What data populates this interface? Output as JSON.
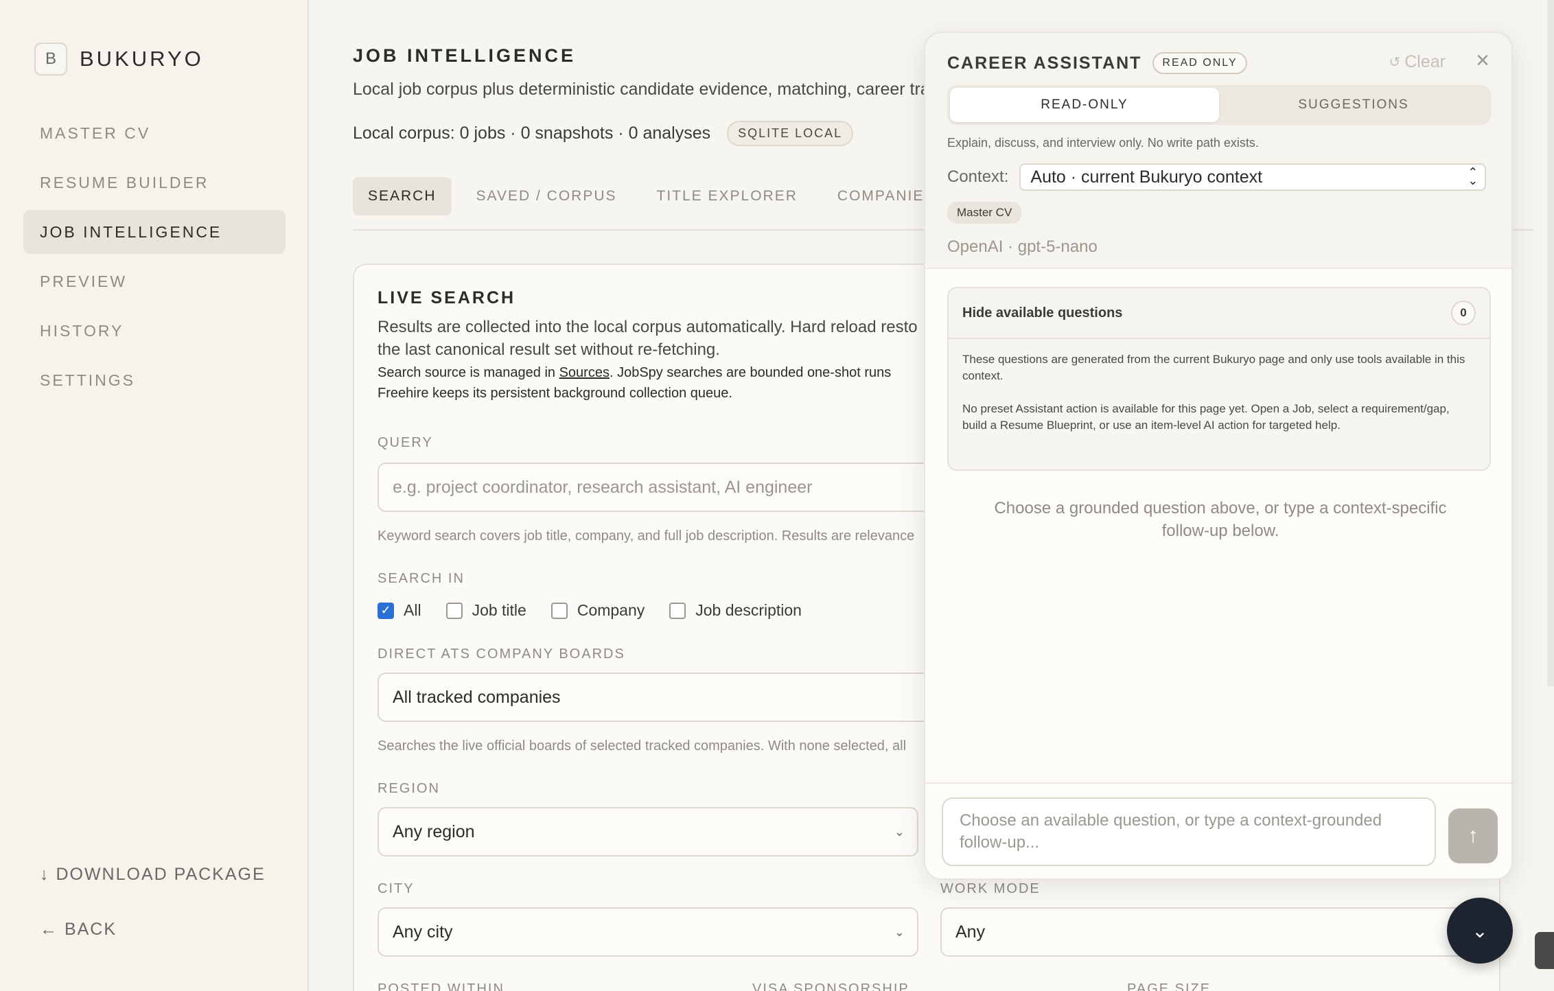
{
  "brand": {
    "mark": "B",
    "name": "BUKURYO"
  },
  "nav": {
    "items": [
      {
        "label": "MASTER CV",
        "active": false
      },
      {
        "label": "RESUME BUILDER",
        "active": false
      },
      {
        "label": "JOB INTELLIGENCE",
        "active": true
      },
      {
        "label": "PREVIEW",
        "active": false
      },
      {
        "label": "HISTORY",
        "active": false
      },
      {
        "label": "SETTINGS",
        "active": false
      }
    ],
    "download": "DOWNLOAD PACKAGE",
    "back": "BACK"
  },
  "page": {
    "title": "JOB INTELLIGENCE",
    "subtitle": "Local job corpus plus deterministic candidate evidence, matching, career tra",
    "corpus": "Local corpus: 0 jobs · 0 snapshots · 0 analyses",
    "storage_badge": "SQLITE LOCAL",
    "tabs": [
      {
        "label": "SEARCH",
        "active": true
      },
      {
        "label": "SAVED / CORPUS",
        "active": false
      },
      {
        "label": "TITLE EXPLORER",
        "active": false
      },
      {
        "label": "COMPANIES",
        "active": false
      }
    ]
  },
  "live_search": {
    "title": "LIVE SEARCH",
    "desc_line1": "Results are collected into the local corpus automatically. Hard reload resto",
    "desc_line2": "the last canonical result set without re-fetching.",
    "note_prefix": "Search source is managed in ",
    "note_link": "Sources",
    "note_suffix": ". JobSpy searches are bounded one-shot runs",
    "note_line2": "Freehire keeps its persistent background collection queue.",
    "query_label": "QUERY",
    "query_placeholder": "e.g. project coordinator, research assistant, AI engineer",
    "query_hint": "Keyword search covers job title, company, and full job description. Results are relevance",
    "search_in_label": "SEARCH IN",
    "search_in": [
      {
        "label": "All",
        "checked": true
      },
      {
        "label": "Job title",
        "checked": false
      },
      {
        "label": "Company",
        "checked": false
      },
      {
        "label": "Job description",
        "checked": false
      }
    ],
    "ats_label": "DIRECT ATS COMPANY BOARDS",
    "ats_value": "All tracked companies",
    "ats_hint": "Searches the live official boards of selected tracked companies. With none selected, all",
    "region_label": "REGION",
    "region_value": "Any region",
    "city_label": "CITY",
    "city_value": "Any city",
    "work_mode_label": "WORK MODE",
    "work_mode_value": "Any",
    "posted_label": "POSTED WITHIN",
    "visa_label": "VISA SPONSORSHIP",
    "page_size_label": "PAGE SIZE"
  },
  "assistant": {
    "title": "CAREER ASSISTANT",
    "badge": "READ ONLY",
    "clear": "Clear",
    "close_icon": "close-icon",
    "modes": [
      {
        "label": "READ-ONLY",
        "active": true
      },
      {
        "label": "SUGGESTIONS",
        "active": false
      }
    ],
    "explain": "Explain, discuss, and interview only. No write path exists.",
    "context_label": "Context:",
    "context_value": "Auto · current Bukuryo context",
    "chip": "Master CV",
    "model": "OpenAI · gpt-5-nano",
    "questions_toggle": "Hide available questions",
    "questions_count": "0",
    "questions_info1": "These questions are generated from the current Bukuryo page and only use tools available in this context.",
    "questions_info2": "No preset Assistant action is available for this page yet. Open a Job, select a requirement/gap, build a Resume Blueprint, or use an item-level AI action for targeted help.",
    "empty_message": "Choose a grounded question above, or type a context-specific follow-up below.",
    "composer_placeholder": "Choose an available question, or type a context-grounded follow-up..."
  }
}
